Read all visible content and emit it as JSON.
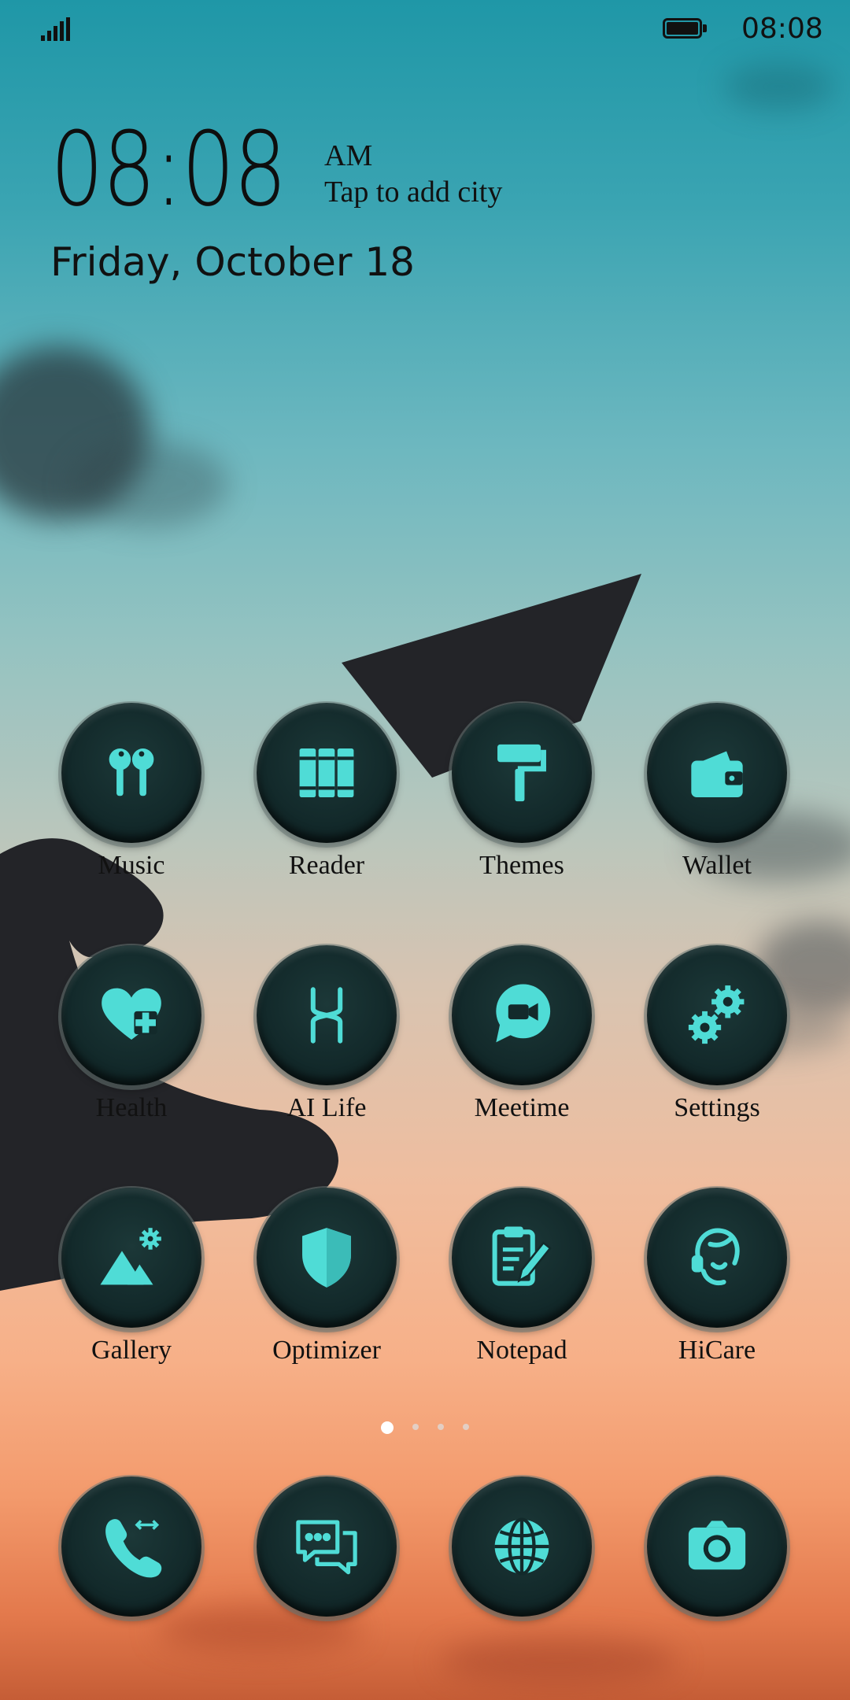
{
  "status_bar": {
    "time": "08:08",
    "signal_icon": "signal-icon",
    "battery_icon": "battery-icon"
  },
  "clock_widget": {
    "time": "08:08",
    "ampm": "AM",
    "city_prompt": "Tap to add city",
    "date": "Friday, October 18"
  },
  "colors": {
    "icon_accent": "#4fdcd6",
    "icon_bg": "#132a2b"
  },
  "apps": [
    {
      "label": "Music",
      "icon": "earbuds-icon"
    },
    {
      "label": "Reader",
      "icon": "books-icon"
    },
    {
      "label": "Themes",
      "icon": "paint-roller-icon"
    },
    {
      "label": "Wallet",
      "icon": "wallet-icon"
    },
    {
      "label": "Health",
      "icon": "heart-plus-icon"
    },
    {
      "label": "AI Life",
      "icon": "ai-life-icon"
    },
    {
      "label": "Meetime",
      "icon": "video-chat-icon"
    },
    {
      "label": "Settings",
      "icon": "gears-icon"
    },
    {
      "label": "Gallery",
      "icon": "mountain-gallery-icon"
    },
    {
      "label": "Optimizer",
      "icon": "shield-icon"
    },
    {
      "label": "Notepad",
      "icon": "clipboard-pencil-icon"
    },
    {
      "label": "HiCare",
      "icon": "headset-agent-icon"
    }
  ],
  "page_indicator": {
    "pages": 4,
    "active": 0
  },
  "dock": [
    {
      "icon": "phone-icon"
    },
    {
      "icon": "messages-icon"
    },
    {
      "icon": "globe-icon"
    },
    {
      "icon": "camera-icon"
    }
  ]
}
